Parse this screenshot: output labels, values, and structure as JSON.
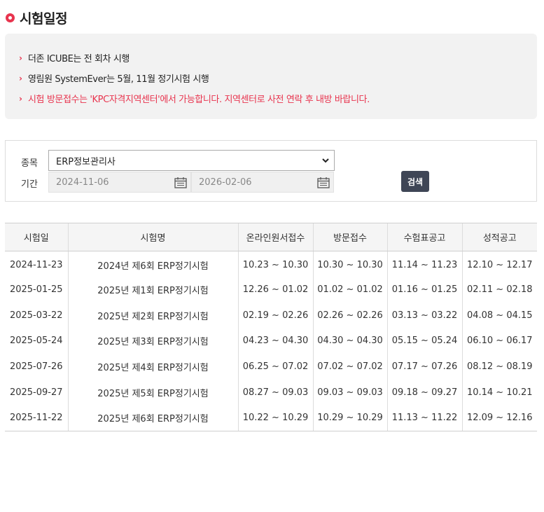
{
  "page": {
    "title": "시험일정"
  },
  "notices": [
    {
      "text": "더존 ICUBE는 전 회차 시행",
      "highlight": false
    },
    {
      "text": "영림원 SystemEver는 5월, 11월 정기시험 시행",
      "highlight": false
    },
    {
      "text": "시험 방문접수는 'KPC자격지역센터'에서 가능합니다. 지역센터로 사전 연락 후 내방 바랍니다.",
      "highlight": true
    }
  ],
  "search": {
    "category_label": "종목",
    "category_value": "ERP정보관리사",
    "period_label": "기간",
    "start_date": "2024-11-06",
    "end_date": "2026-02-06",
    "button_label": "검색"
  },
  "table": {
    "headers": [
      "시험일",
      "시험명",
      "온라인원서접수",
      "방문접수",
      "수험표공고",
      "성적공고"
    ],
    "rows": [
      [
        "2024-11-23",
        "2024년 제6회 ERP정기시험",
        "10.23 ~ 10.30",
        "10.30 ~ 10.30",
        "11.14 ~ 11.23",
        "12.10 ~ 12.17"
      ],
      [
        "2025-01-25",
        "2025년 제1회 ERP정기시험",
        "12.26 ~ 01.02",
        "01.02 ~ 01.02",
        "01.16 ~ 01.25",
        "02.11 ~ 02.18"
      ],
      [
        "2025-03-22",
        "2025년 제2회 ERP정기시험",
        "02.19 ~ 02.26",
        "02.26 ~ 02.26",
        "03.13 ~ 03.22",
        "04.08 ~ 04.15"
      ],
      [
        "2025-05-24",
        "2025년 제3회 ERP정기시험",
        "04.23 ~ 04.30",
        "04.30 ~ 04.30",
        "05.15 ~ 05.24",
        "06.10 ~ 06.17"
      ],
      [
        "2025-07-26",
        "2025년 제4회 ERP정기시험",
        "06.25 ~ 07.02",
        "07.02 ~ 07.02",
        "07.17 ~ 07.26",
        "08.12 ~ 08.19"
      ],
      [
        "2025-09-27",
        "2025년 제5회 ERP정기시험",
        "08.27 ~ 09.03",
        "09.03 ~ 09.03",
        "09.18 ~ 09.27",
        "10.14 ~ 10.21"
      ],
      [
        "2025-11-22",
        "2025년 제6회 ERP정기시험",
        "10.22 ~ 10.29",
        "10.29 ~ 10.29",
        "11.13 ~ 11.22",
        "12.09 ~ 12.16"
      ]
    ]
  },
  "colors": {
    "accent": "#e8344e",
    "button_bg": "#3f4656",
    "notice_bg": "#f2f2f2"
  },
  "icons": {
    "title_bullet": "circle-bullet-icon",
    "notice_bullet": "chevron-right-icon",
    "date_picker": "calendar-icon",
    "select_arrow": "chevron-down-icon"
  }
}
